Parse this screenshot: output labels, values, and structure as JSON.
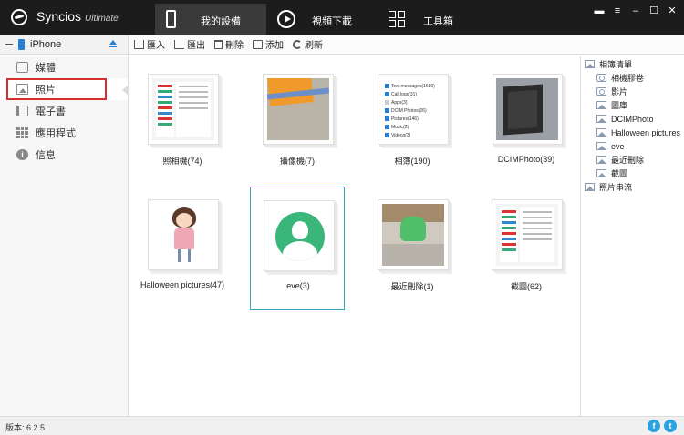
{
  "app": {
    "name": "Syncios",
    "edition": "Ultimate"
  },
  "topnav": [
    {
      "label": "我的設備",
      "icon": "phone-icon",
      "active": true
    },
    {
      "label": "視頻下載",
      "icon": "play-icon",
      "active": false
    },
    {
      "label": "工具箱",
      "icon": "toolbox-icon",
      "active": false
    }
  ],
  "window_controls": [
    "chat-icon",
    "menu-icon",
    "minimize-icon",
    "maximize-icon",
    "close-icon"
  ],
  "device": {
    "name": "iPhone"
  },
  "toolbar": {
    "import_label": "匯入",
    "export_label": "匯出",
    "delete_label": "刪除",
    "add_label": "添加",
    "refresh_label": "刷新"
  },
  "sidebar": {
    "items": [
      {
        "label": "媒體",
        "icon": "media-icon"
      },
      {
        "label": "照片",
        "icon": "photo-icon",
        "selected": true
      },
      {
        "label": "電子書",
        "icon": "ebook-icon"
      },
      {
        "label": "應用程式",
        "icon": "apps-icon"
      },
      {
        "label": "信息",
        "icon": "info-icon"
      }
    ]
  },
  "albums": [
    {
      "label": "照相機(74)"
    },
    {
      "label": "攝像機(7)"
    },
    {
      "label": "相簿(190)"
    },
    {
      "label": "DCIMPhoto(39)"
    },
    {
      "label": "Halloween pictures(47)"
    },
    {
      "label": "eve(3)",
      "selected": true
    },
    {
      "label": "最近刪除(1)"
    },
    {
      "label": "截圖(62)"
    }
  ],
  "thumb_list": [
    {
      "text": "Text messages(1680)",
      "checked": true
    },
    {
      "text": "Call logs(31)",
      "checked": true
    },
    {
      "text": "Apps(3)",
      "checked": false
    },
    {
      "text": "DCIM Photos(26)",
      "checked": true
    },
    {
      "text": "Pictures(146)",
      "checked": true
    },
    {
      "text": "Music(2)",
      "checked": true
    },
    {
      "text": "Videos(3)",
      "checked": true
    }
  ],
  "album_tree": {
    "root": "相簿清單",
    "children": [
      {
        "label": "相機膠卷",
        "icon": "camera-icon"
      },
      {
        "label": "影片",
        "icon": "camera-icon"
      },
      {
        "label": "圖庫",
        "icon": "picture-icon"
      },
      {
        "label": "DCIMPhoto",
        "icon": "picture-icon"
      },
      {
        "label": "Halloween pictures",
        "icon": "picture-icon"
      },
      {
        "label": "eve",
        "icon": "picture-icon"
      },
      {
        "label": "最近刪除",
        "icon": "picture-icon"
      },
      {
        "label": "截圖",
        "icon": "picture-icon"
      }
    ],
    "stream": "照片串流"
  },
  "status": {
    "version": "版本: 6.2.5"
  },
  "colors": {
    "titlebar": "#1c1c1c",
    "accent": "#2a7fd0",
    "selection_border": "#3aa7c8",
    "highlight_box": "#d32f2f",
    "avatar_green": "#3ab67a"
  }
}
